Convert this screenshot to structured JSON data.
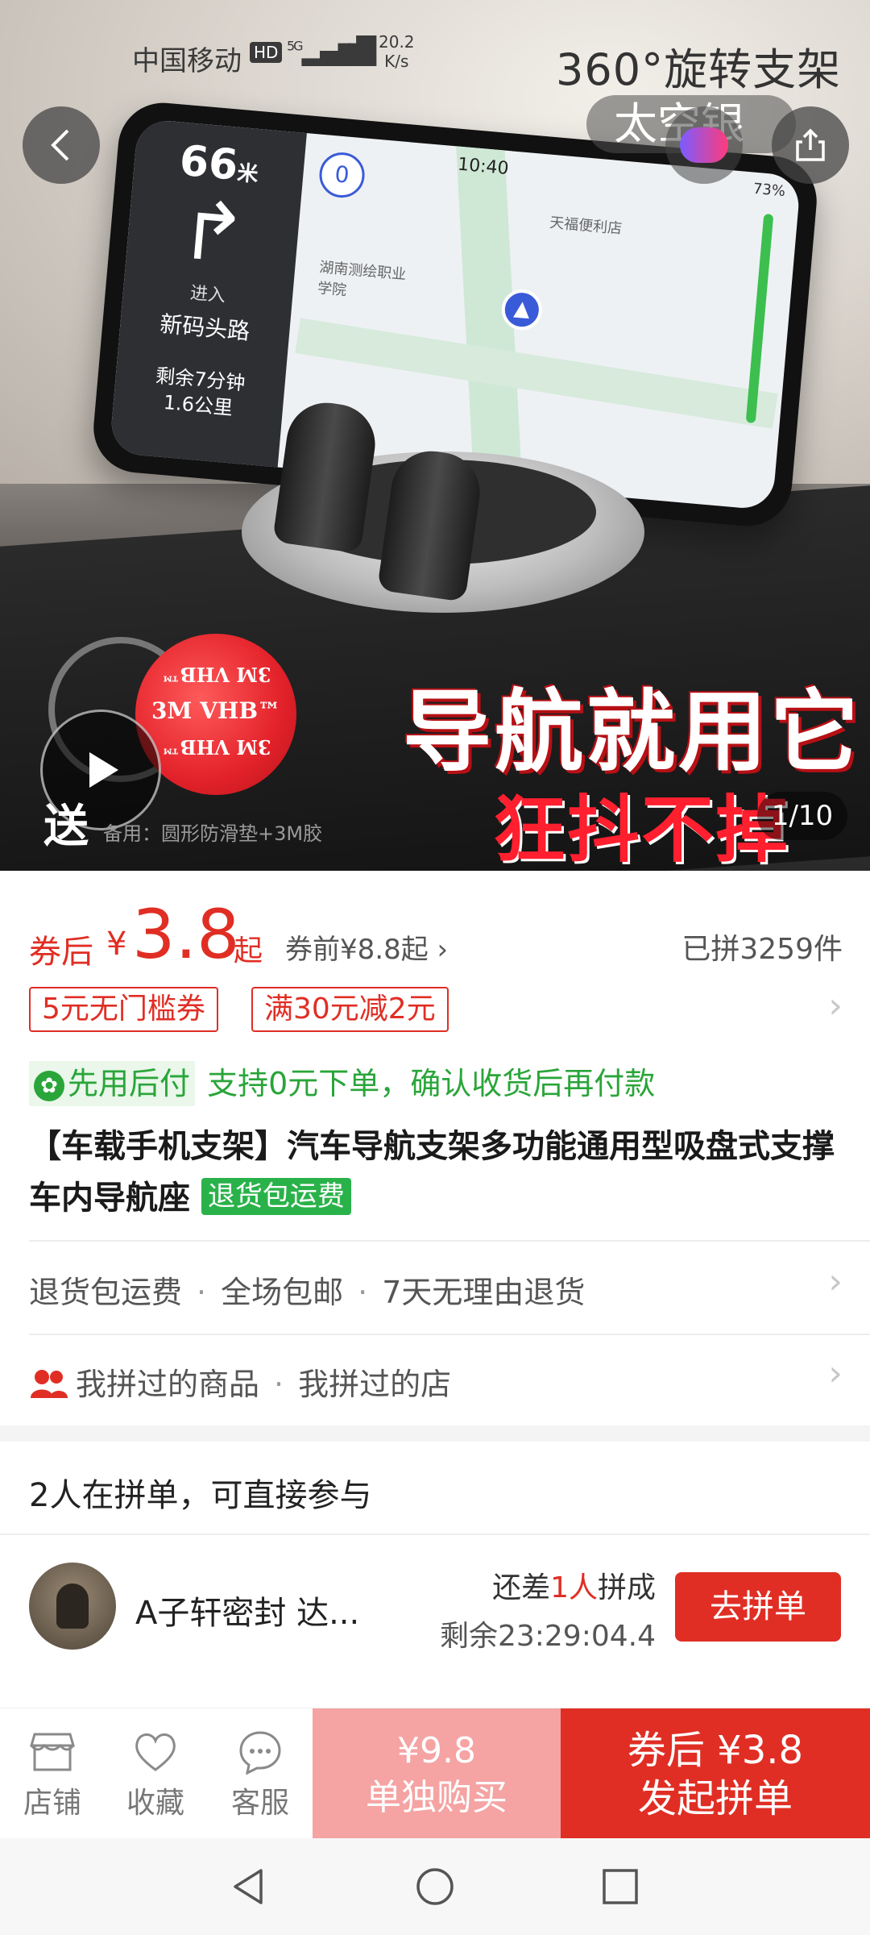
{
  "status_bar": {
    "carrier": "中国移动",
    "hd": "HD",
    "network": "5G",
    "speed_value": "20.2",
    "speed_unit": "K/s"
  },
  "hero": {
    "overlay_title": "360°旋转支架",
    "brand_text": "太空银",
    "image_counter": "1/10",
    "slogan_main": "导航就用它",
    "slogan_sub": "狂抖不掉",
    "gift_char": "送",
    "gift_note": "备用：圆形防滑垫+3M胶",
    "sticker_text": "3M VHB™",
    "phone_screen": {
      "distance": "66",
      "distance_unit": "米",
      "enter_label": "进入",
      "road_name": "新码头路",
      "remaining": "剩余7分钟",
      "remaining_dist": "1.6公里",
      "time": "10:40",
      "speed": "0",
      "battery": "73%",
      "poi_1": "天福便利店",
      "poi_2": "湖南测绘职业学院"
    }
  },
  "price": {
    "prefix": "券后",
    "currency": "¥",
    "value": "3.8",
    "suffix": "起",
    "original": "券前¥8.8起",
    "sold": "已拼3259件"
  },
  "coupons": [
    "5元无门槛券",
    "满30元减2元"
  ],
  "bnpl": {
    "tag": "先用后付",
    "desc": "支持0元下单，确认收货后再付款"
  },
  "product": {
    "title": "【车载手机支架】汽车导航支架多功能通用型吸盘式支撑车内导航座",
    "badge": "退货包运费"
  },
  "services": [
    "退货包运费",
    "全场包邮",
    "7天无理由退货"
  ],
  "history": [
    "我拼过的商品",
    "我拼过的店"
  ],
  "group": {
    "heading": "2人在拼单，可直接参与",
    "name": "A子轩密封  达...",
    "need_prefix": "还差",
    "need_count": "1人",
    "need_suffix": "拼成",
    "time_left": "剩余23:29:04.4",
    "join_label": "去拼单"
  },
  "action_bar": {
    "shop": "店铺",
    "favorite": "收藏",
    "service": "客服",
    "single_price": "¥9.8",
    "single_label": "单独购买",
    "group_price": "券后 ¥3.8",
    "group_label": "发起拼单"
  },
  "colors": {
    "accent": "#e02e24",
    "accent_light": "#f5a3a3",
    "green": "#2aa53a"
  }
}
